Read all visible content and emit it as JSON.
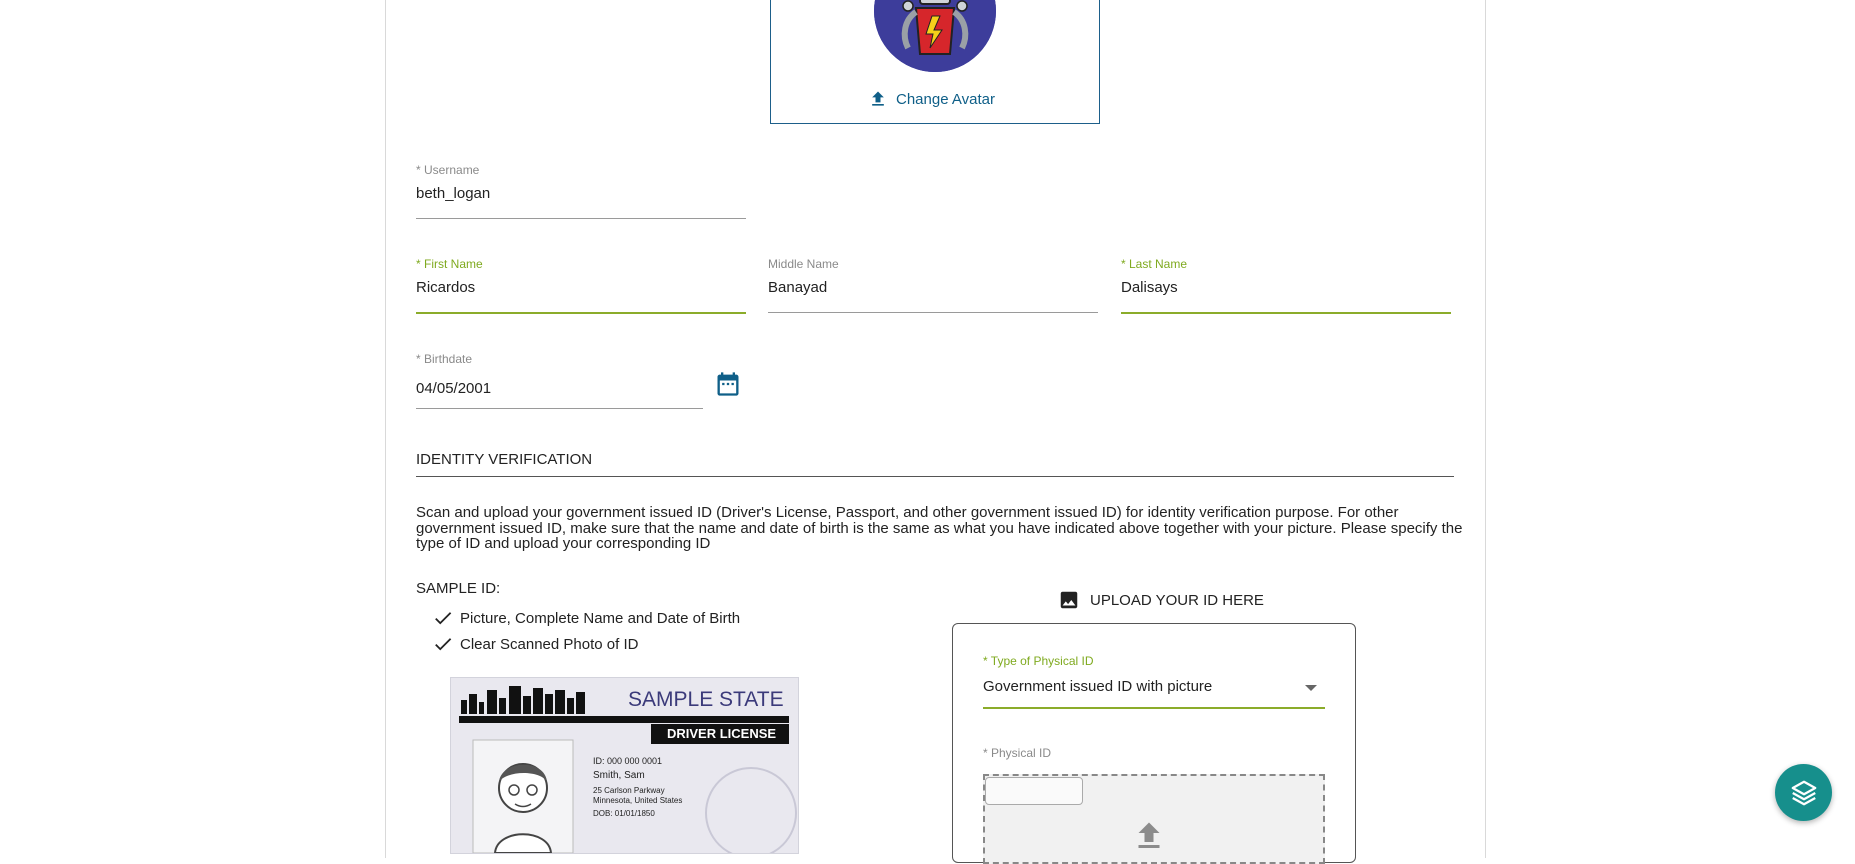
{
  "avatar": {
    "change_label": "Change Avatar"
  },
  "fields": {
    "username": {
      "label": "* Username",
      "value": "beth_logan"
    },
    "first_name": {
      "label": "* First Name",
      "value": "Ricardos"
    },
    "middle_name": {
      "label": "Middle Name",
      "value": "Banayad"
    },
    "last_name": {
      "label": "* Last Name",
      "value": "Dalisays"
    },
    "birthdate": {
      "label": "* Birthdate",
      "value": "04/05/2001"
    }
  },
  "identity": {
    "title": "IDENTITY VERIFICATION",
    "description": "Scan and upload your government issued ID (Driver's License, Passport, and other government issued ID) for identity verification purpose. For other government issued ID, make sure that the name and date of birth is the same as what you have indicated above together with your picture. Please specify the type of ID and upload your corresponding ID",
    "sample_title": "SAMPLE ID:",
    "checklist": [
      "Picture, Complete Name and Date of Birth",
      "Clear Scanned Photo of ID"
    ],
    "sample_card": {
      "state": "SAMPLE STATE",
      "type": "DRIVER LICENSE",
      "id_line": "ID: 000 000 0001",
      "name": "Smith, Sam",
      "address1": "25 Carlson Parkway",
      "address2": "Minnesota, United States",
      "dob": "DOB: 01/01/1850"
    },
    "upload_title": "UPLOAD YOUR ID HERE",
    "type_label": "* Type of Physical ID",
    "type_value": "Government issued ID with picture",
    "physical_id_label": "* Physical ID"
  },
  "colors": {
    "accent_green": "#8bac2a",
    "link_blue": "#0f5f88",
    "fab_teal": "#168f8c",
    "avatar_bg": "#3d3d9b"
  },
  "icons": {
    "upload": "upload-icon",
    "calendar": "calendar-icon",
    "image": "image-icon",
    "check": "check-icon",
    "fab": "layers-icon"
  }
}
